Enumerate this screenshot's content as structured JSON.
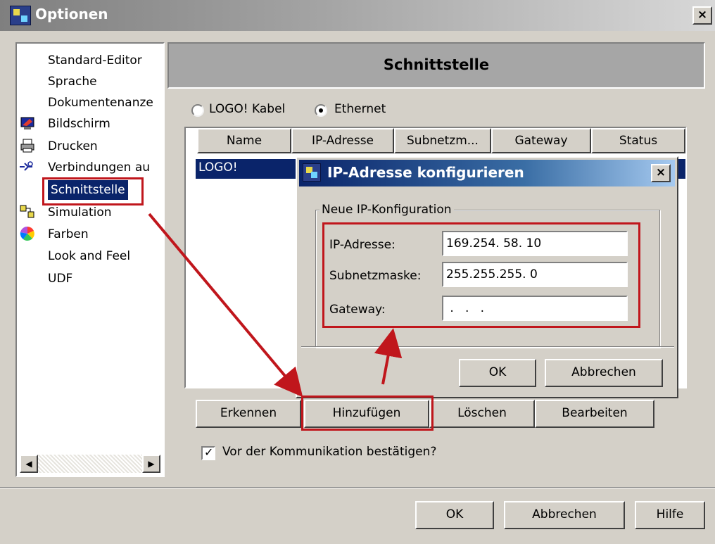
{
  "window": {
    "title": "Optionen",
    "close_label": "×"
  },
  "tree": {
    "items": [
      {
        "label": "Standard-Editor",
        "icon": "none"
      },
      {
        "label": "Sprache",
        "icon": "none"
      },
      {
        "label": "Dokumentenanze",
        "icon": "none"
      },
      {
        "label": "Bildschirm",
        "icon": "monitor-icon"
      },
      {
        "label": "Drucken",
        "icon": "printer-icon"
      },
      {
        "label": "Verbindungen au",
        "icon": "connection-icon"
      },
      {
        "label": "Schnittstelle",
        "icon": "none",
        "selected": true
      },
      {
        "label": "Simulation",
        "icon": "simulation-icon"
      },
      {
        "label": "Farben",
        "icon": "color-wheel-icon"
      },
      {
        "label": "Look and Feel",
        "icon": "none"
      },
      {
        "label": "UDF",
        "icon": "none"
      }
    ],
    "scroll_left": "◀",
    "scroll_right": "▶"
  },
  "panel": {
    "title": "Schnittstelle",
    "radio_cable": "LOGO! Kabel",
    "radio_ethernet": "Ethernet",
    "selected_radio": "ethernet",
    "table": {
      "columns": [
        "Name",
        "IP-Adresse",
        "Subnetzm...",
        "Gateway",
        "Status"
      ],
      "rows": [
        [
          "LOGO!",
          "",
          "",
          "",
          ""
        ]
      ]
    },
    "buttons": {
      "detect": "Erkennen",
      "add": "Hinzufügen",
      "delete": "Löschen",
      "edit": "Bearbeiten"
    },
    "confirm_checkbox": "Vor der Kommunikation bestätigen?",
    "confirm_checked": true
  },
  "dialog": {
    "title": "IP-Adresse konfigurieren",
    "close_label": "×",
    "group_label": "Neue IP-Konfiguration",
    "ip_label": "IP-Adresse:",
    "ip_value": "169.254. 58. 10",
    "subnet_label": "Subnetzmaske:",
    "subnet_value": "255.255.255.  0",
    "gateway_label": "Gateway:",
    "gateway_value": " .   .   .",
    "ok": "OK",
    "cancel": "Abbrechen"
  },
  "footer": {
    "ok": "OK",
    "cancel": "Abbrechen",
    "help": "Hilfe"
  },
  "colors": {
    "highlight": "#0a246a",
    "annotation": "#c0161c",
    "face": "#d4d0c8"
  }
}
